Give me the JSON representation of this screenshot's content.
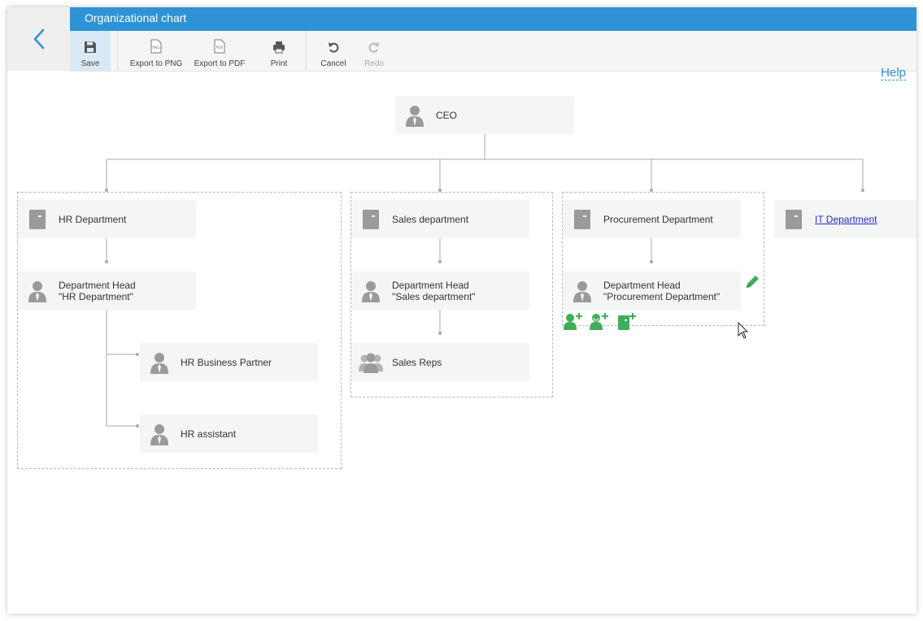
{
  "window": {
    "title": "Organizational chart"
  },
  "toolbar": {
    "save": "Save",
    "export_png": "Export to PNG",
    "export_pdf": "Export to PDF",
    "print": "Print",
    "cancel": "Cancel",
    "redo": "Redo",
    "help": "Help"
  },
  "icons": {
    "png_text": "PNG",
    "pdf_text": "PDF"
  },
  "colors": {
    "title_bar": "#2e93d6",
    "accent": "#2e93d6",
    "node_icon": "#9a9a9a",
    "action_green": "#3fae5a",
    "link": "#2a2acc"
  },
  "chart": {
    "ceo": {
      "label": "CEO"
    },
    "hr": {
      "department": "HR Department",
      "head_line1": "Department Head",
      "head_line2": "\"HR Department\"",
      "business_partner": "HR Business Partner",
      "assistant": "HR assistant"
    },
    "sales": {
      "department": "Sales department",
      "head_line1": "Department Head",
      "head_line2": "\"Sales department\"",
      "reps": "Sales Reps"
    },
    "procurement": {
      "department": "Procurement Department",
      "head_line1": "Department Head",
      "head_line2": "\"Procurement Department\""
    },
    "it": {
      "department": "IT Department"
    }
  }
}
